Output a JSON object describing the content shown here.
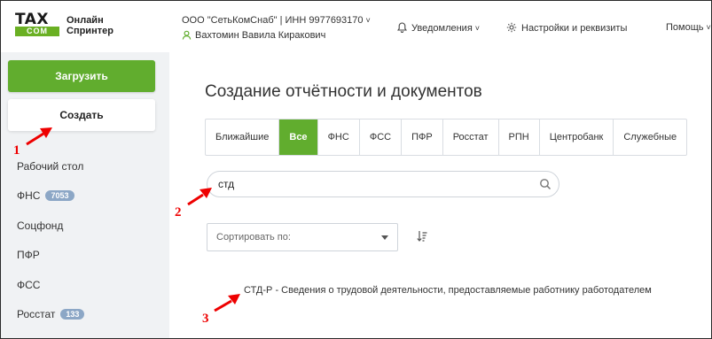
{
  "header": {
    "logo_tax": "TAX",
    "logo_com": "COM",
    "logo_line1": "Онлайн",
    "logo_line2": "Спринтер",
    "org": "ООО \"СетьКомСнаб\" | ИНН 9977693170",
    "user": "Вахтомин Вавила Киракович",
    "notifications": "Уведомления",
    "settings": "Настройки и реквизиты",
    "help": "Помощь"
  },
  "sidebar": {
    "upload_label": "Загрузить",
    "create_label": "Создать",
    "items": [
      {
        "label": "Рабочий стол"
      },
      {
        "label": "ФНС",
        "badge": "7053"
      },
      {
        "label": "Соцфонд"
      },
      {
        "label": "ПФР"
      },
      {
        "label": "ФСС"
      },
      {
        "label": "Росстат",
        "badge": "133"
      }
    ]
  },
  "main": {
    "title": "Создание отчётности и документов",
    "tabs": [
      {
        "label": "Ближайшие"
      },
      {
        "label": "Все",
        "active": true
      },
      {
        "label": "ФНС"
      },
      {
        "label": "ФСС"
      },
      {
        "label": "ПФР"
      },
      {
        "label": "Росстат"
      },
      {
        "label": "РПН"
      },
      {
        "label": "Центробанк"
      },
      {
        "label": "Служебные"
      }
    ],
    "search_value": "стд",
    "sort_placeholder": "Сортировать по:",
    "result": "СТД-Р - Сведения о трудовой деятельности, предоставляемые работнику работодателем"
  },
  "annotations": {
    "one": "1",
    "two": "2",
    "three": "3"
  },
  "colors": {
    "accent_green": "#61ad2e",
    "badge": "#8ca7c6",
    "annotation_red": "#e00000"
  }
}
